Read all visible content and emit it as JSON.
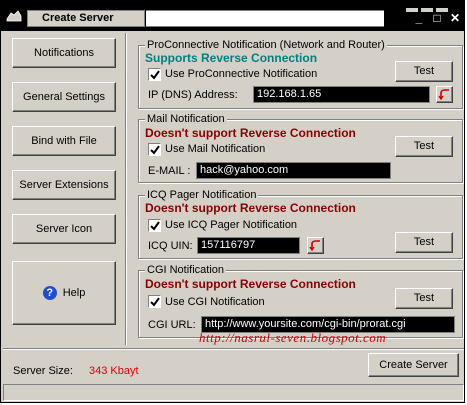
{
  "window": {
    "title": "Create Server"
  },
  "titlebar": {
    "minimize_glyph": "_",
    "maximize_glyph": "□",
    "close_glyph": "✕"
  },
  "sidebar": {
    "items": [
      {
        "label": "Notifications"
      },
      {
        "label": "General Settings"
      },
      {
        "label": "Bind with File"
      },
      {
        "label": "Server Extensions"
      },
      {
        "label": "Server Icon"
      }
    ],
    "help": {
      "label": "Help",
      "icon": "help-icon"
    }
  },
  "proconnective": {
    "title": "ProConnective Notification (Network and Router)",
    "notice": "Supports Reverse Connection",
    "notice_color": "#008080",
    "checkbox_label": "Use ProConnective Notification",
    "checked": true,
    "field_label": "IP (DNS) Address:",
    "field_value": "192.168.1.65",
    "test_label": "Test"
  },
  "mail": {
    "title": "Mail Notification",
    "notice": "Doesn't support Reverse Connection",
    "notice_color": "#8b0000",
    "checkbox_label": "Use Mail Notification",
    "checked": true,
    "field_label": "E-MAIL :",
    "field_value": "hack@yahoo.com",
    "test_label": "Test"
  },
  "icq": {
    "title": "ICQ Pager Notification",
    "notice": "Doesn't support Reverse Connection",
    "checkbox_label": "Use ICQ Pager Notification",
    "checked": true,
    "field_label": "ICQ UIN:",
    "field_value": "157116797",
    "test_label": "Test"
  },
  "cgi": {
    "title": "CGI Notification",
    "notice": "Doesn't support Reverse Connection",
    "checkbox_label": "Use CGI Notification",
    "checked": true,
    "field_label": "CGI URL:",
    "field_value": "http://www.yoursite.com/cgi-bin/prorat.cgi",
    "test_label": "Test"
  },
  "watermark": "http://nasrul-seven.blogspot.com",
  "footer": {
    "size_label": "Server Size:",
    "size_value": "343 Kbayt",
    "create_label": "Create Server"
  }
}
